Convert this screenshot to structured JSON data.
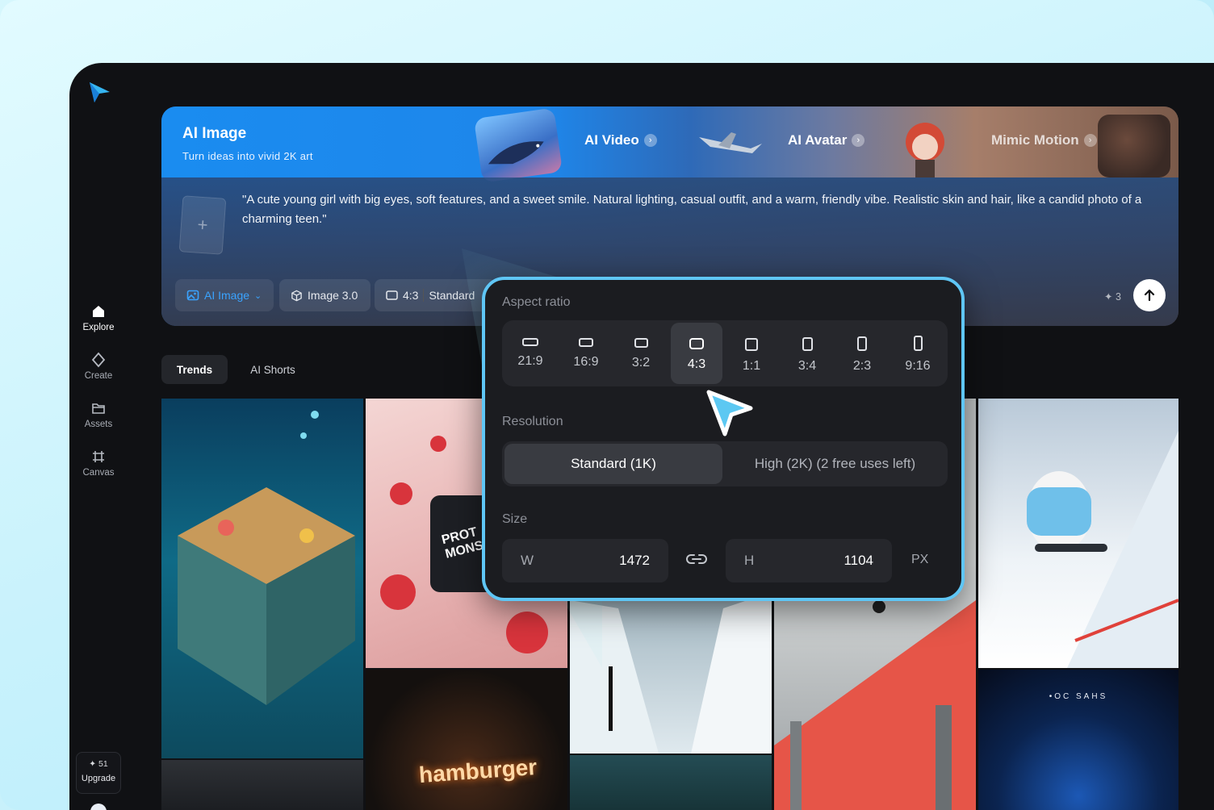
{
  "sidebar": {
    "items": [
      {
        "label": "Explore",
        "icon": "home-icon"
      },
      {
        "label": "Create",
        "icon": "diamond-icon"
      },
      {
        "label": "Assets",
        "icon": "folder-icon"
      },
      {
        "label": "Canvas",
        "icon": "frame-grid-icon"
      }
    ],
    "credits": "✦ 51",
    "upgrade_label": "Upgrade"
  },
  "hero": {
    "active_tab": {
      "title": "AI Image",
      "subtitle": "Turn ideas into vivid 2K art"
    },
    "tabs": [
      "AI Video",
      "AI Avatar",
      "Mimic Motion"
    ],
    "prompt": "\"A cute young girl with big eyes, soft features, and a sweet smile. Natural lighting, casual outfit, and a warm, friendly vibe. Realistic skin and hair, like a candid photo of a charming teen.\"",
    "upload_plus": "+",
    "toolbar": {
      "mode": "AI Image",
      "model": "Image 3.0",
      "ratio": "4:3",
      "quality": "Standard",
      "credits": "✦ 3"
    }
  },
  "trend_tabs": [
    "Trends",
    "AI Shorts"
  ],
  "gallery": {
    "captions": {
      "hamburger": "hamburger",
      "poster": "•OC SAHS",
      "protein": "PROT MONS"
    }
  },
  "popover": {
    "aspect_label": "Aspect ratio",
    "ratios": [
      "21:9",
      "16:9",
      "3:2",
      "4:3",
      "1:1",
      "3:4",
      "2:3",
      "9:16"
    ],
    "selected_ratio": "4:3",
    "resolution_label": "Resolution",
    "resolution_standard": "Standard (1K)",
    "resolution_high": "High (2K)  (2 free uses left)",
    "size_label": "Size",
    "width_label": "W",
    "width_value": "1472",
    "height_label": "H",
    "height_value": "1104",
    "unit": "PX"
  },
  "colors": {
    "accent": "#3aa3ff",
    "popover_border": "#5fc6f5",
    "cursor": "#5cc8f2"
  }
}
